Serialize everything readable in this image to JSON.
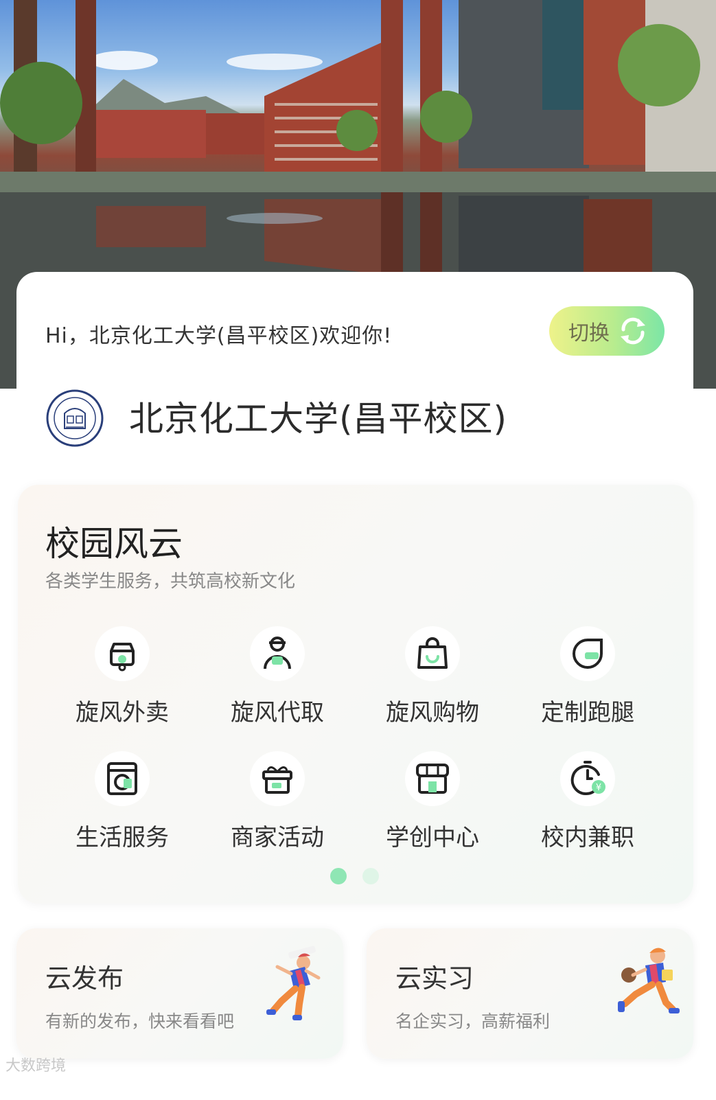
{
  "header": {
    "welcome": "Hi，北京化工大学(昌平校区)欢迎你!",
    "switch_label": "切换"
  },
  "school": {
    "name": "北京化工大学(昌平校区)"
  },
  "services_section": {
    "title": "校园风云",
    "subtitle": "各类学生服务，共筑高校新文化",
    "items": [
      {
        "label": "旋风外卖",
        "icon": "scooter-icon"
      },
      {
        "label": "旋风代取",
        "icon": "courier-icon"
      },
      {
        "label": "旋风购物",
        "icon": "shopping-bag-icon"
      },
      {
        "label": "定制跑腿",
        "icon": "errand-icon"
      },
      {
        "label": "生活服务",
        "icon": "washing-machine-icon"
      },
      {
        "label": "商家活动",
        "icon": "gift-icon"
      },
      {
        "label": "学创中心",
        "icon": "store-icon"
      },
      {
        "label": "校内兼职",
        "icon": "clock-yuan-icon"
      }
    ],
    "page_count": 2,
    "active_page": 1
  },
  "cards": [
    {
      "title": "云发布",
      "subtitle": "有新的发布，快来看看吧"
    },
    {
      "title": "云实习",
      "subtitle": "名企实习，高薪福利"
    }
  ],
  "watermark": "大数跨境",
  "colors": {
    "accent_green": "#7de3a6",
    "accent_yellow": "#eef28a",
    "icon_dark": "#222222"
  }
}
